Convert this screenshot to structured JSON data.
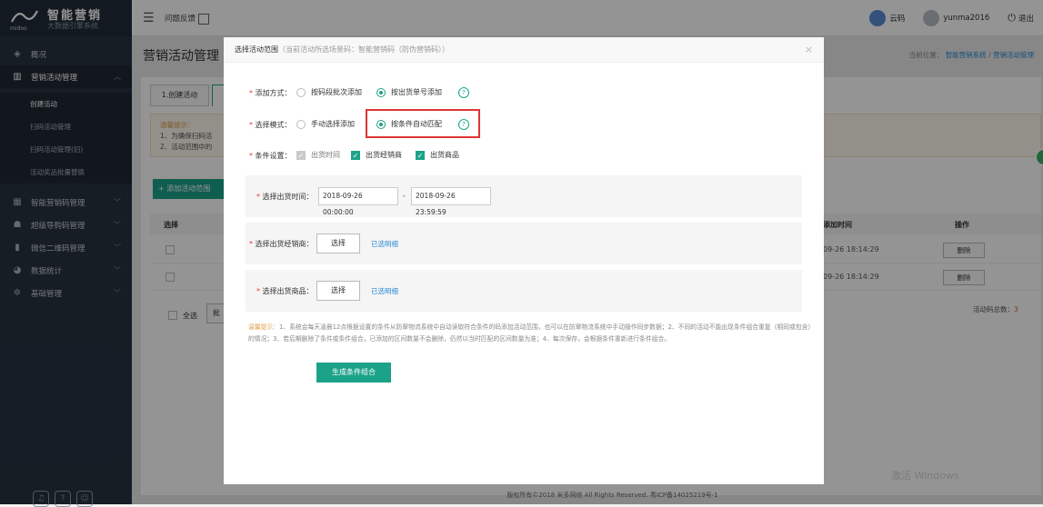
{
  "sidebar": {
    "brand": "智能营销",
    "brand_sub": "大数据引擎系统",
    "logo_small": "midoo",
    "items": [
      {
        "label": "概况",
        "icon": "dashboard-icon"
      },
      {
        "label": "营销活动管理",
        "icon": "chart-bars-icon"
      },
      {
        "label": "智能营销码管理",
        "icon": "qrcode-icon"
      },
      {
        "label": "超级导购码管理",
        "icon": "people-icon"
      },
      {
        "label": "微信二维码管理",
        "icon": "barcode-icon"
      },
      {
        "label": "数据统计",
        "icon": "pie-icon"
      },
      {
        "label": "基础管理",
        "icon": "gear-icon"
      }
    ],
    "sub_items": [
      "创建活动",
      "扫码活动管理",
      "扫码活动管理(旧)",
      "活动奖品批量替换"
    ]
  },
  "topbar": {
    "feedback": "问题反馈",
    "user1": "云码",
    "user2": "yunma2016",
    "logout": "退出"
  },
  "page": {
    "title": "营销活动管理",
    "crumb_prefix": "当前位置：",
    "crumb_1": "智能营销系统",
    "crumb_sep": "/",
    "crumb_2": "营销活动管理",
    "tab1": "1.创建活动",
    "hint_title": "温馨提示：",
    "hint_1": "1、为确保扫码活",
    "hint_2": "2、活动范围中的",
    "add_button": "+ 添加活动范围",
    "table": {
      "col_select": "选择",
      "col_time": "添加时间",
      "col_action": "操作",
      "rows": [
        {
          "time": "09-26 18:14:29",
          "action": "删除"
        },
        {
          "time": "09-26 18:14:29",
          "action": "删除"
        }
      ]
    },
    "select_all": "全选",
    "batch": "批",
    "total_label": "活动码总数：",
    "total_value": "3"
  },
  "footer": "版权所有©2018 米多网络 All Rights Reserved. 粤ICP备14025219号-1",
  "watermark": "激活 Windows",
  "modal": {
    "title": "选择活动范围",
    "subtitle": "（当前活动所选场景码：智能营销码（防伪营销码））",
    "add_method_label": "添加方式：",
    "add_method_opt1": "按码段批次添加",
    "add_method_opt2": "按出货单号添加",
    "select_mode_label": "选择模式：",
    "select_mode_opt1": "手动选择添加",
    "select_mode_opt2": "按条件自动匹配",
    "cond_label": "条件设置：",
    "cond_opt1": "出货时间",
    "cond_opt2": "出货经销商",
    "cond_opt3": "出货商品",
    "ship_time_label": "选择出货时间：",
    "ship_time_start": "2018-09-26 00:00:00",
    "ship_time_dash": "-",
    "ship_time_end": "2018-09-26 23:59:59",
    "dealer_label": "选择出货经销商：",
    "dealer_btn": "选择",
    "dealer_link": "已选明细",
    "product_label": "选择出货商品：",
    "product_btn": "选择",
    "product_link": "已选明细",
    "tip_title": "温馨提示：",
    "tip_text": "1、系统会每天凌晨12点根据设置的条件从防窜物流系统中自动读取符合条件的码添加活动范围，也可以在防窜物流系统中手动操作同步数据；2、不同的活动不能出现条件组合重复（相同或包含）的情况；3、若后期删除了条件或条件组合，已添加的区间数量不会删除，仍然以当时匹配的区间数量为准；4、每次保存，会根据条件重新进行条件组合。",
    "generate_btn": "生成条件组合"
  }
}
